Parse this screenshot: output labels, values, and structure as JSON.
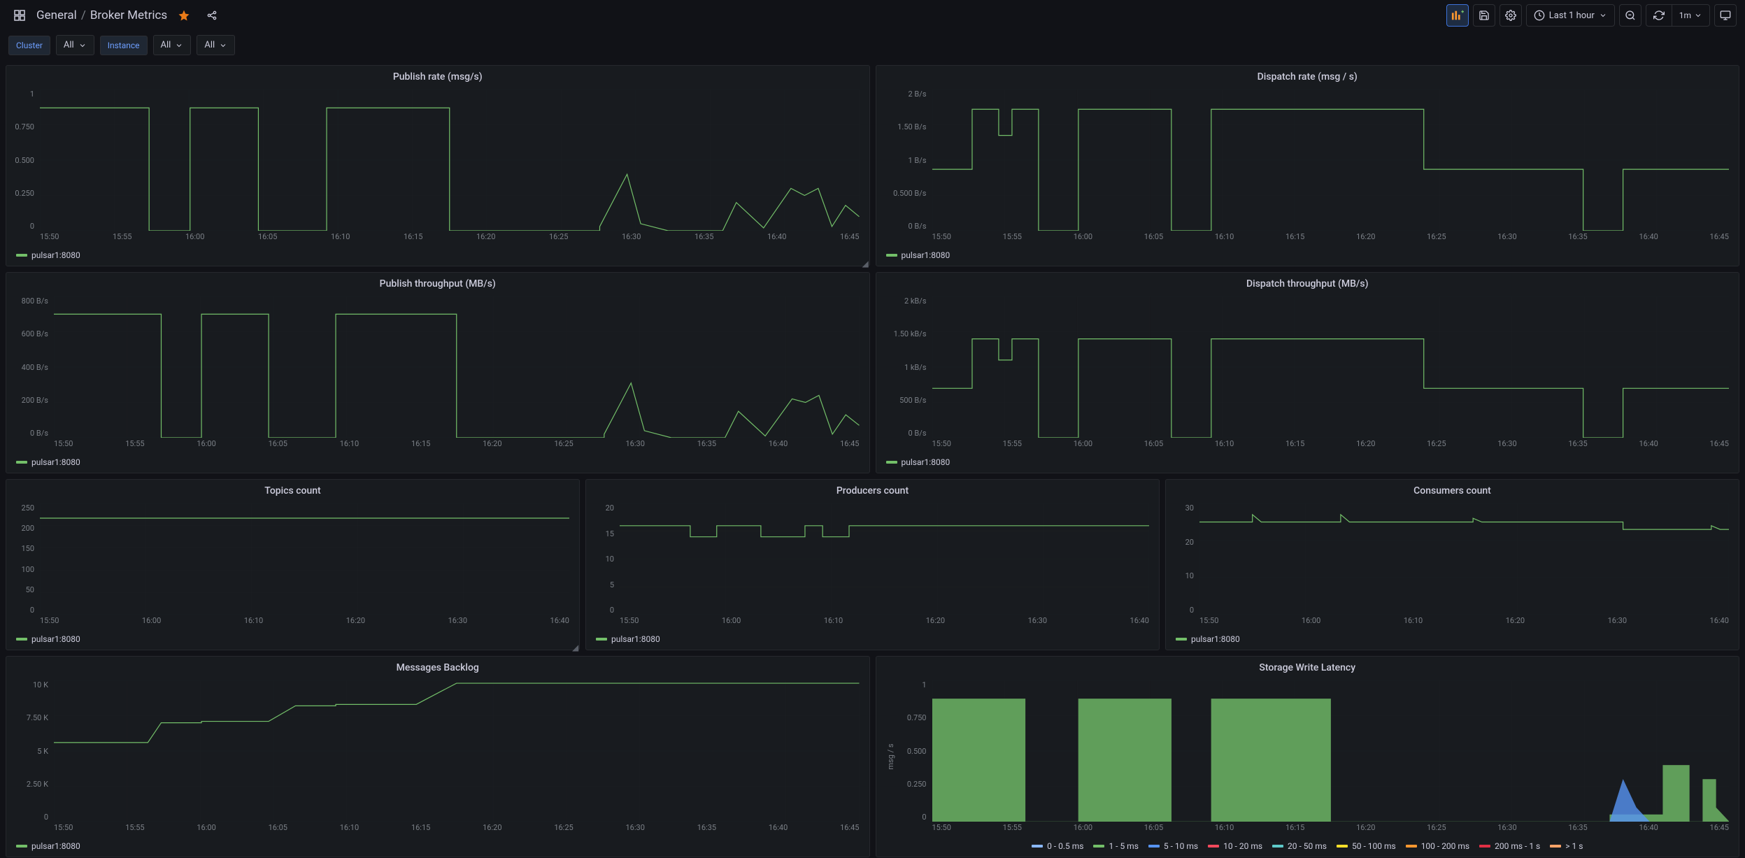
{
  "header": {
    "breadcrumb_folder": "General",
    "breadcrumb_sep": "/",
    "breadcrumb_title": "Broker Metrics",
    "time_range": "Last 1 hour",
    "refresh_interval": "1m"
  },
  "variables": {
    "cluster_label": "Cluster",
    "cluster_value": "All",
    "instance_label": "Instance",
    "instance_value": "All",
    "extra_value": "All"
  },
  "legend_series": "pulsar1:8080",
  "x_ticks_12": [
    "15:50",
    "15:55",
    "16:00",
    "16:05",
    "16:10",
    "16:15",
    "16:20",
    "16:25",
    "16:30",
    "16:35",
    "16:40",
    "16:45"
  ],
  "x_ticks_6": [
    "15:50",
    "16:00",
    "16:10",
    "16:20",
    "16:30",
    "16:40"
  ],
  "storage_legend": [
    {
      "label": "0 - 0.5 ms",
      "color": "#8ab8ff"
    },
    {
      "label": "1 - 5 ms",
      "color": "#73bf69"
    },
    {
      "label": "5 - 10 ms",
      "color": "#5794f2"
    },
    {
      "label": "10 - 20 ms",
      "color": "#f2495c"
    },
    {
      "label": "20 - 50 ms",
      "color": "#5ec9c9"
    },
    {
      "label": "50 - 100 ms",
      "color": "#fade2a"
    },
    {
      "label": "100 - 200 ms",
      "color": "#ff9830"
    },
    {
      "label": "200 ms - 1 s",
      "color": "#e02f44"
    },
    {
      "label": "> 1 s",
      "color": "#ffa368"
    }
  ],
  "panels": {
    "publish_rate": {
      "title": "Publish rate (msg/s)",
      "y_ticks": [
        "1",
        "0.750",
        "0.500",
        "0.250",
        "0"
      ]
    },
    "dispatch_rate": {
      "title": "Dispatch rate (msg / s)",
      "y_ticks": [
        "2 B/s",
        "1.50 B/s",
        "1 B/s",
        "0.500 B/s",
        "0 B/s"
      ]
    },
    "publish_throughput": {
      "title": "Publish throughput (MB/s)",
      "y_ticks": [
        "800 B/s",
        "600 B/s",
        "400 B/s",
        "200 B/s",
        "0 B/s"
      ]
    },
    "dispatch_throughput": {
      "title": "Dispatch throughput (MB/s)",
      "y_ticks": [
        "2 kB/s",
        "1.50 kB/s",
        "1 kB/s",
        "500 B/s",
        "0 B/s"
      ]
    },
    "topics": {
      "title": "Topics count",
      "y_ticks": [
        "250",
        "200",
        "150",
        "100",
        "50",
        "0"
      ]
    },
    "producers": {
      "title": "Producers count",
      "y_ticks": [
        "20",
        "15",
        "10",
        "5",
        "0"
      ]
    },
    "consumers": {
      "title": "Consumers count",
      "y_ticks": [
        "30",
        "20",
        "10",
        "0"
      ]
    },
    "backlog": {
      "title": "Messages Backlog",
      "y_ticks": [
        "10 K",
        "7.50 K",
        "5 K",
        "2.50 K",
        "0"
      ]
    },
    "storage": {
      "title": "Storage Write Latency",
      "y_label": "msg / s",
      "y_ticks": [
        "1",
        "0.750",
        "0.500",
        "0.250",
        "0"
      ]
    }
  },
  "chart_data": [
    {
      "panel": "publish_rate",
      "type": "line",
      "ylim": [
        0,
        1
      ],
      "xlim": [
        "15:47",
        "16:47"
      ],
      "title": "Publish rate (msg/s)",
      "series": [
        {
          "name": "pulsar1:8080",
          "values": [
            [
              "15:47",
              0.87
            ],
            [
              "15:55",
              0.87
            ],
            [
              "15:55",
              0
            ],
            [
              "15:58",
              0
            ],
            [
              "15:58",
              0.87
            ],
            [
              "16:03",
              0.87
            ],
            [
              "16:03",
              0
            ],
            [
              "16:08",
              0
            ],
            [
              "16:08",
              0.87
            ],
            [
              "16:17",
              0.87
            ],
            [
              "16:17",
              0
            ],
            [
              "16:28",
              0
            ],
            [
              "16:28",
              0.03
            ],
            [
              "16:30",
              0.4
            ],
            [
              "16:31",
              0.05
            ],
            [
              "16:33",
              0
            ],
            [
              "16:37",
              0
            ],
            [
              "16:38",
              0.2
            ],
            [
              "16:40",
              0.02
            ],
            [
              "16:42",
              0.3
            ],
            [
              "16:43",
              0.25
            ],
            [
              "16:44",
              0.3
            ],
            [
              "16:45",
              0.03
            ],
            [
              "16:46",
              0.18
            ],
            [
              "16:47",
              0.1
            ]
          ]
        }
      ]
    },
    {
      "panel": "dispatch_rate",
      "type": "line",
      "ylim": [
        0,
        2
      ],
      "yunit": "B/s",
      "xlim": [
        "15:47",
        "16:47"
      ],
      "title": "Dispatch rate (msg / s)",
      "series": [
        {
          "name": "pulsar1:8080",
          "values": [
            [
              "15:47",
              0.87
            ],
            [
              "15:50",
              0.87
            ],
            [
              "15:50",
              1.72
            ],
            [
              "15:52",
              1.72
            ],
            [
              "15:52",
              1.35
            ],
            [
              "15:53",
              1.35
            ],
            [
              "15:53",
              1.72
            ],
            [
              "15:55",
              1.72
            ],
            [
              "15:55",
              0
            ],
            [
              "15:58",
              0
            ],
            [
              "15:58",
              1.72
            ],
            [
              "16:05",
              1.72
            ],
            [
              "16:05",
              0
            ],
            [
              "16:08",
              0
            ],
            [
              "16:08",
              1.72
            ],
            [
              "16:24",
              1.72
            ],
            [
              "16:24",
              0.87
            ],
            [
              "16:36",
              0.87
            ],
            [
              "16:36",
              0
            ],
            [
              "16:39",
              0
            ],
            [
              "16:39",
              0.87
            ],
            [
              "16:47",
              0.87
            ]
          ]
        }
      ]
    },
    {
      "panel": "publish_throughput",
      "type": "line",
      "ylim": [
        0,
        800
      ],
      "yunit": "B/s",
      "xlim": [
        "15:47",
        "16:47"
      ],
      "title": "Publish throughput (MB/s)",
      "series": [
        {
          "name": "pulsar1:8080",
          "values": [
            [
              "15:47",
              700
            ],
            [
              "15:55",
              700
            ],
            [
              "15:55",
              0
            ],
            [
              "15:58",
              0
            ],
            [
              "15:58",
              700
            ],
            [
              "16:03",
              700
            ],
            [
              "16:03",
              0
            ],
            [
              "16:08",
              0
            ],
            [
              "16:08",
              700
            ],
            [
              "16:17",
              700
            ],
            [
              "16:17",
              0
            ],
            [
              "16:28",
              0
            ],
            [
              "16:28",
              20
            ],
            [
              "16:30",
              310
            ],
            [
              "16:31",
              40
            ],
            [
              "16:33",
              0
            ],
            [
              "16:37",
              0
            ],
            [
              "16:38",
              150
            ],
            [
              "16:40",
              10
            ],
            [
              "16:42",
              220
            ],
            [
              "16:43",
              200
            ],
            [
              "16:44",
              240
            ],
            [
              "16:45",
              20
            ],
            [
              "16:46",
              130
            ],
            [
              "16:47",
              70
            ]
          ]
        }
      ]
    },
    {
      "panel": "dispatch_throughput",
      "type": "line",
      "ylim": [
        0,
        2000
      ],
      "yunit": "B/s",
      "xlim": [
        "15:47",
        "16:47"
      ],
      "title": "Dispatch throughput (MB/s)",
      "series": [
        {
          "name": "pulsar1:8080",
          "values": [
            [
              "15:47",
              700
            ],
            [
              "15:50",
              700
            ],
            [
              "15:50",
              1400
            ],
            [
              "15:52",
              1400
            ],
            [
              "15:52",
              1100
            ],
            [
              "15:53",
              1100
            ],
            [
              "15:53",
              1400
            ],
            [
              "15:55",
              1400
            ],
            [
              "15:55",
              0
            ],
            [
              "15:58",
              0
            ],
            [
              "15:58",
              1400
            ],
            [
              "16:05",
              1400
            ],
            [
              "16:05",
              0
            ],
            [
              "16:08",
              0
            ],
            [
              "16:08",
              1400
            ],
            [
              "16:24",
              1400
            ],
            [
              "16:24",
              700
            ],
            [
              "16:36",
              700
            ],
            [
              "16:36",
              0
            ],
            [
              "16:39",
              0
            ],
            [
              "16:39",
              700
            ],
            [
              "16:47",
              700
            ]
          ]
        }
      ]
    },
    {
      "panel": "topics",
      "type": "line",
      "ylim": [
        0,
        250
      ],
      "xlim": [
        "15:47",
        "16:47"
      ],
      "title": "Topics count",
      "series": [
        {
          "name": "pulsar1:8080",
          "values": [
            [
              "15:47",
              217
            ],
            [
              "16:47",
              217
            ]
          ]
        }
      ]
    },
    {
      "panel": "producers",
      "type": "line",
      "ylim": [
        0,
        20
      ],
      "xlim": [
        "15:47",
        "16:47"
      ],
      "title": "Producers count",
      "series": [
        {
          "name": "pulsar1:8080",
          "values": [
            [
              "15:47",
              16
            ],
            [
              "15:55",
              16
            ],
            [
              "15:55",
              14
            ],
            [
              "15:58",
              14
            ],
            [
              "15:58",
              16
            ],
            [
              "16:03",
              16
            ],
            [
              "16:03",
              14
            ],
            [
              "16:08",
              14
            ],
            [
              "16:08",
              16
            ],
            [
              "16:10",
              16
            ],
            [
              "16:10",
              14
            ],
            [
              "16:13",
              14
            ],
            [
              "16:13",
              16
            ],
            [
              "16:47",
              16
            ]
          ]
        }
      ]
    },
    {
      "panel": "consumers",
      "type": "line",
      "ylim": [
        0,
        30
      ],
      "xlim": [
        "15:47",
        "16:47"
      ],
      "title": "Consumers count",
      "series": [
        {
          "name": "pulsar1:8080",
          "values": [
            [
              "15:47",
              25
            ],
            [
              "15:53",
              25
            ],
            [
              "15:53",
              27
            ],
            [
              "15:54",
              25
            ],
            [
              "16:03",
              25
            ],
            [
              "16:03",
              27
            ],
            [
              "16:04",
              25
            ],
            [
              "16:18",
              25
            ],
            [
              "16:18",
              26
            ],
            [
              "16:19",
              25
            ],
            [
              "16:35",
              25
            ],
            [
              "16:35",
              23
            ],
            [
              "16:45",
              23
            ],
            [
              "16:45",
              24
            ],
            [
              "16:46",
              23
            ],
            [
              "16:47",
              23
            ]
          ]
        }
      ]
    },
    {
      "panel": "backlog",
      "type": "line",
      "ylim": [
        0,
        10000
      ],
      "xlim": [
        "15:47",
        "16:47"
      ],
      "title": "Messages Backlog",
      "series": [
        {
          "name": "pulsar1:8080",
          "values": [
            [
              "15:47",
              5600
            ],
            [
              "15:54",
              5600
            ],
            [
              "15:55",
              7000
            ],
            [
              "15:58",
              7000
            ],
            [
              "15:58",
              7100
            ],
            [
              "16:03",
              7100
            ],
            [
              "16:05",
              8200
            ],
            [
              "16:08",
              8200
            ],
            [
              "16:08",
              8300
            ],
            [
              "16:14",
              8300
            ],
            [
              "16:17",
              9800
            ],
            [
              "16:47",
              9800
            ]
          ]
        }
      ]
    },
    {
      "panel": "storage",
      "type": "area",
      "ylim": [
        0,
        1
      ],
      "yunit": "msg / s",
      "xlim": [
        "15:47",
        "16:47"
      ],
      "title": "Storage Write Latency",
      "series": [
        {
          "name": "1 - 5 ms",
          "color": "#73bf69",
          "values": [
            [
              "15:47",
              0.87
            ],
            [
              "15:54",
              0.87
            ],
            [
              "15:54",
              0
            ],
            [
              "15:58",
              0
            ],
            [
              "15:58",
              0.87
            ],
            [
              "16:05",
              0.87
            ],
            [
              "16:05",
              0
            ],
            [
              "16:08",
              0
            ],
            [
              "16:08",
              0.87
            ],
            [
              "16:17",
              0.87
            ],
            [
              "16:17",
              0
            ],
            [
              "16:38",
              0
            ],
            [
              "16:38",
              0.05
            ],
            [
              "16:42",
              0.05
            ],
            [
              "16:42",
              0.4
            ],
            [
              "16:44",
              0.4
            ],
            [
              "16:44",
              0
            ],
            [
              "16:45",
              0
            ],
            [
              "16:45",
              0.3
            ],
            [
              "16:46",
              0.3
            ],
            [
              "16:46",
              0.1
            ],
            [
              "16:47",
              0
            ]
          ]
        },
        {
          "name": "5 - 10 ms",
          "color": "#5794f2",
          "values": [
            [
              "16:38",
              0
            ],
            [
              "16:39",
              0.3
            ],
            [
              "16:40",
              0.1
            ],
            [
              "16:41",
              0
            ]
          ]
        }
      ]
    }
  ]
}
